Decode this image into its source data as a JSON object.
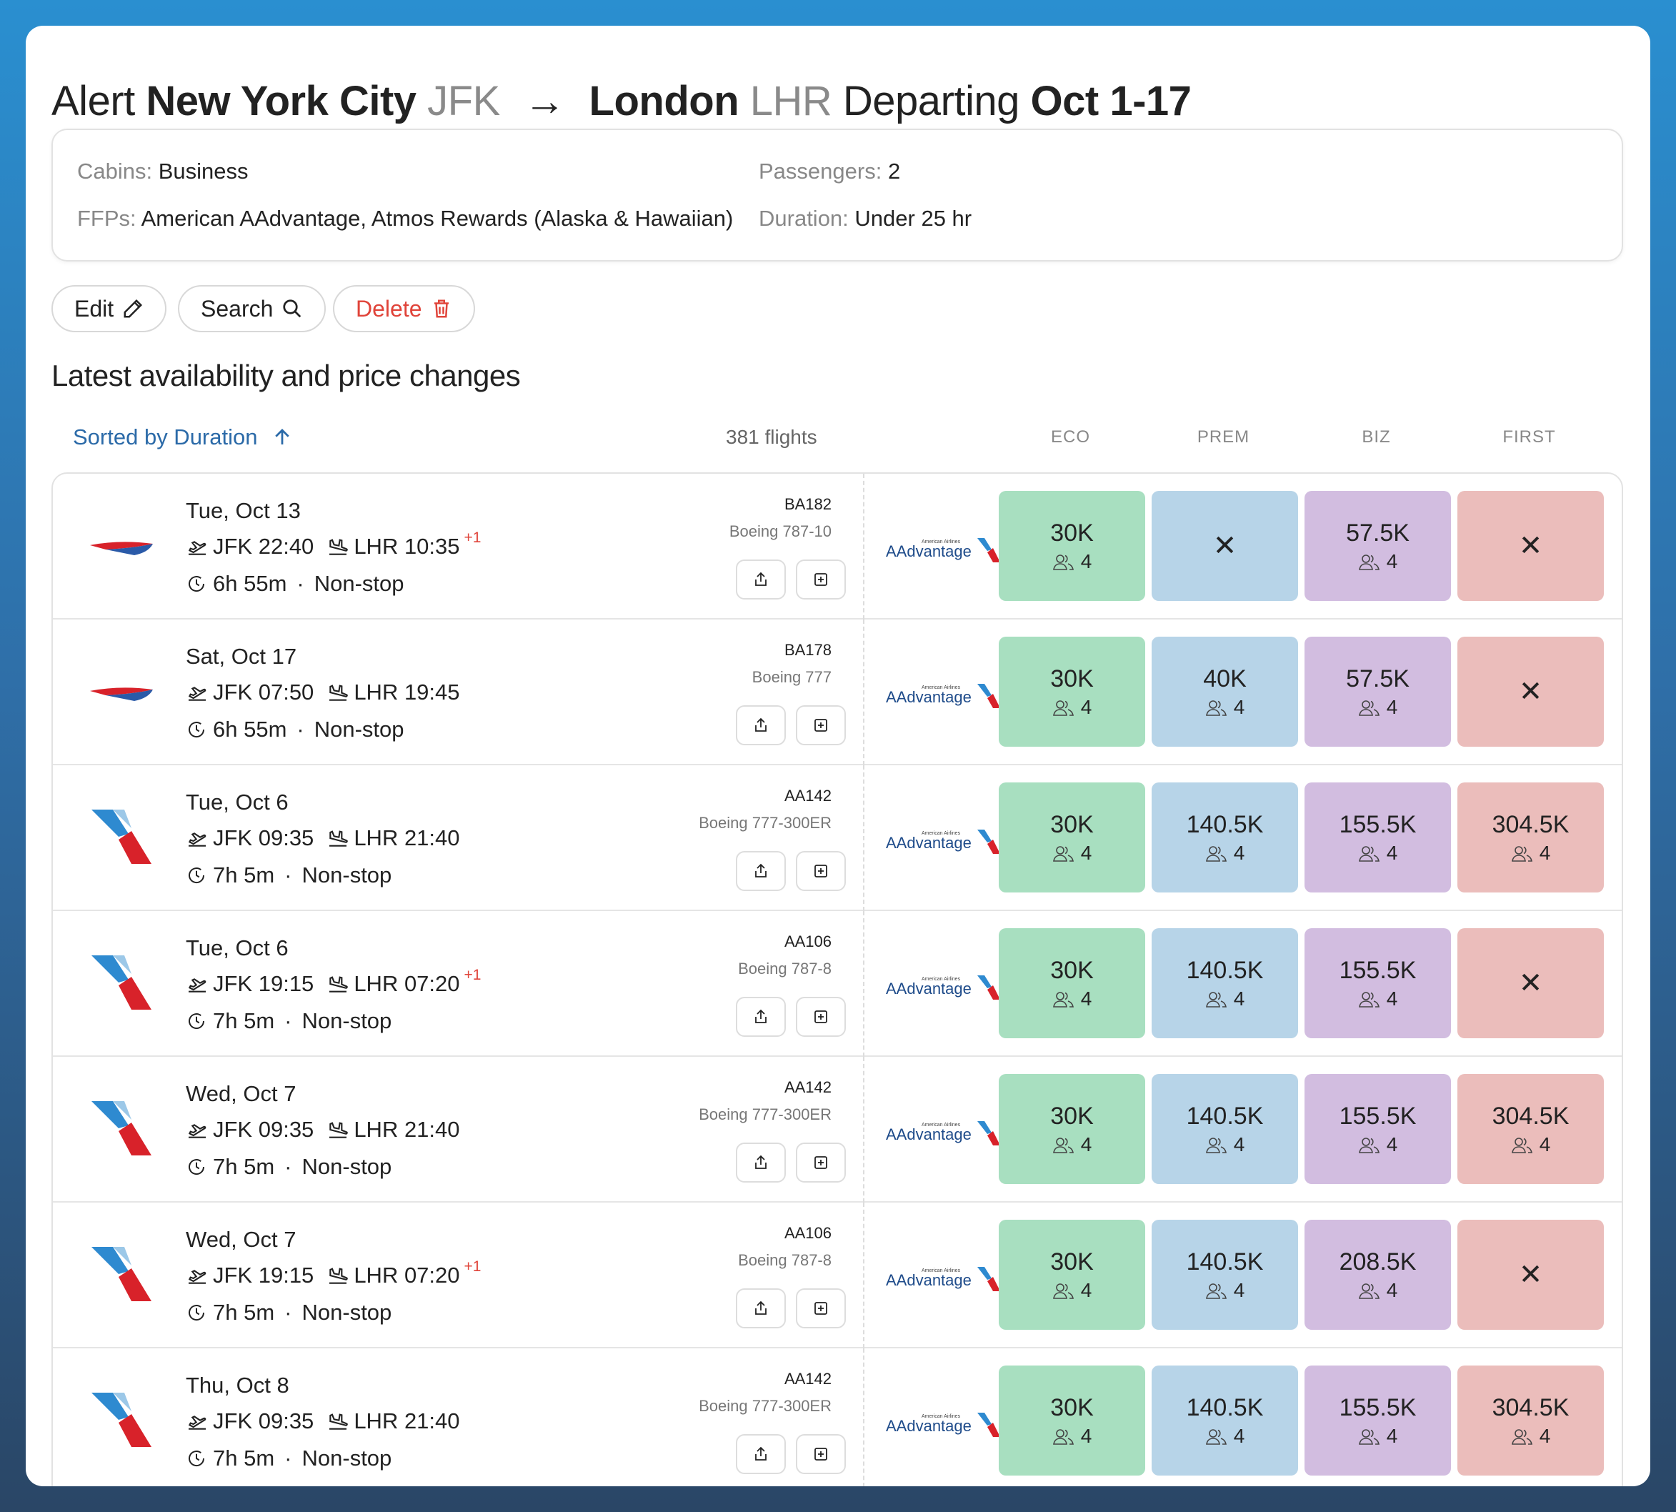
{
  "title": {
    "prefix": "Alert",
    "origin_city": "New York City",
    "origin_code": "JFK",
    "arrow": "→",
    "dest_city": "London",
    "dest_code": "LHR",
    "departing_label": "Departing",
    "dates": "Oct 1-17"
  },
  "filters": {
    "cabins_label": "Cabins:",
    "cabins_value": "Business",
    "ffps_label": "FFPs:",
    "ffps_value": "American AAdvantage, Atmos Rewards (Alaska & Hawaiian)",
    "passengers_label": "Passengers:",
    "passengers_value": "2",
    "duration_label": "Duration:",
    "duration_value": "Under 25 hr"
  },
  "actions": {
    "edit": "Edit",
    "search": "Search",
    "delete": "Delete"
  },
  "section_title": "Latest availability and price changes",
  "sort_label": "Sorted by Duration",
  "flight_count": "381 flights",
  "columns": [
    "ECO",
    "PREM",
    "BIZ",
    "FIRST"
  ],
  "program_logo_text": "AAdvantage",
  "program_logo_small": "American Airlines",
  "colors": {
    "eco": "#a8dfc0",
    "prem": "#b7d4e8",
    "biz": "#d2bde0",
    "first": "#ebbdbb",
    "accent": "#2b6aa8",
    "danger": "#e0443a"
  },
  "rows": [
    {
      "airline": "ba",
      "date": "Tue, Oct 13",
      "dep": "JFK 22:40",
      "arr": "LHR 10:35",
      "plus": "+1",
      "duration": "6h 55m",
      "stops": "Non-stop",
      "flight": "BA182",
      "aircraft": "Boeing 787-10",
      "prices": [
        {
          "p": "30K",
          "s": "4"
        },
        null,
        {
          "p": "57.5K",
          "s": "4"
        },
        null
      ]
    },
    {
      "airline": "ba",
      "date": "Sat, Oct 17",
      "dep": "JFK 07:50",
      "arr": "LHR 19:45",
      "plus": "",
      "duration": "6h 55m",
      "stops": "Non-stop",
      "flight": "BA178",
      "aircraft": "Boeing 777",
      "prices": [
        {
          "p": "30K",
          "s": "4"
        },
        {
          "p": "40K",
          "s": "4"
        },
        {
          "p": "57.5K",
          "s": "4"
        },
        null
      ]
    },
    {
      "airline": "aa",
      "date": "Tue, Oct 6",
      "dep": "JFK 09:35",
      "arr": "LHR 21:40",
      "plus": "",
      "duration": "7h 5m",
      "stops": "Non-stop",
      "flight": "AA142",
      "aircraft": "Boeing 777-300ER",
      "prices": [
        {
          "p": "30K",
          "s": "4"
        },
        {
          "p": "140.5K",
          "s": "4"
        },
        {
          "p": "155.5K",
          "s": "4"
        },
        {
          "p": "304.5K",
          "s": "4"
        }
      ]
    },
    {
      "airline": "aa",
      "date": "Tue, Oct 6",
      "dep": "JFK 19:15",
      "arr": "LHR 07:20",
      "plus": "+1",
      "duration": "7h 5m",
      "stops": "Non-stop",
      "flight": "AA106",
      "aircraft": "Boeing 787-8",
      "prices": [
        {
          "p": "30K",
          "s": "4"
        },
        {
          "p": "140.5K",
          "s": "4"
        },
        {
          "p": "155.5K",
          "s": "4"
        },
        null
      ]
    },
    {
      "airline": "aa",
      "date": "Wed, Oct 7",
      "dep": "JFK 09:35",
      "arr": "LHR 21:40",
      "plus": "",
      "duration": "7h 5m",
      "stops": "Non-stop",
      "flight": "AA142",
      "aircraft": "Boeing 777-300ER",
      "prices": [
        {
          "p": "30K",
          "s": "4"
        },
        {
          "p": "140.5K",
          "s": "4"
        },
        {
          "p": "155.5K",
          "s": "4"
        },
        {
          "p": "304.5K",
          "s": "4"
        }
      ]
    },
    {
      "airline": "aa",
      "date": "Wed, Oct 7",
      "dep": "JFK 19:15",
      "arr": "LHR 07:20",
      "plus": "+1",
      "duration": "7h 5m",
      "stops": "Non-stop",
      "flight": "AA106",
      "aircraft": "Boeing 787-8",
      "prices": [
        {
          "p": "30K",
          "s": "4"
        },
        {
          "p": "140.5K",
          "s": "4"
        },
        {
          "p": "208.5K",
          "s": "4"
        },
        null
      ]
    },
    {
      "airline": "aa",
      "date": "Thu, Oct 8",
      "dep": "JFK 09:35",
      "arr": "LHR 21:40",
      "plus": "",
      "duration": "7h 5m",
      "stops": "Non-stop",
      "flight": "AA142",
      "aircraft": "Boeing 777-300ER",
      "prices": [
        {
          "p": "30K",
          "s": "4"
        },
        {
          "p": "140.5K",
          "s": "4"
        },
        {
          "p": "155.5K",
          "s": "4"
        },
        {
          "p": "304.5K",
          "s": "4"
        }
      ]
    }
  ]
}
